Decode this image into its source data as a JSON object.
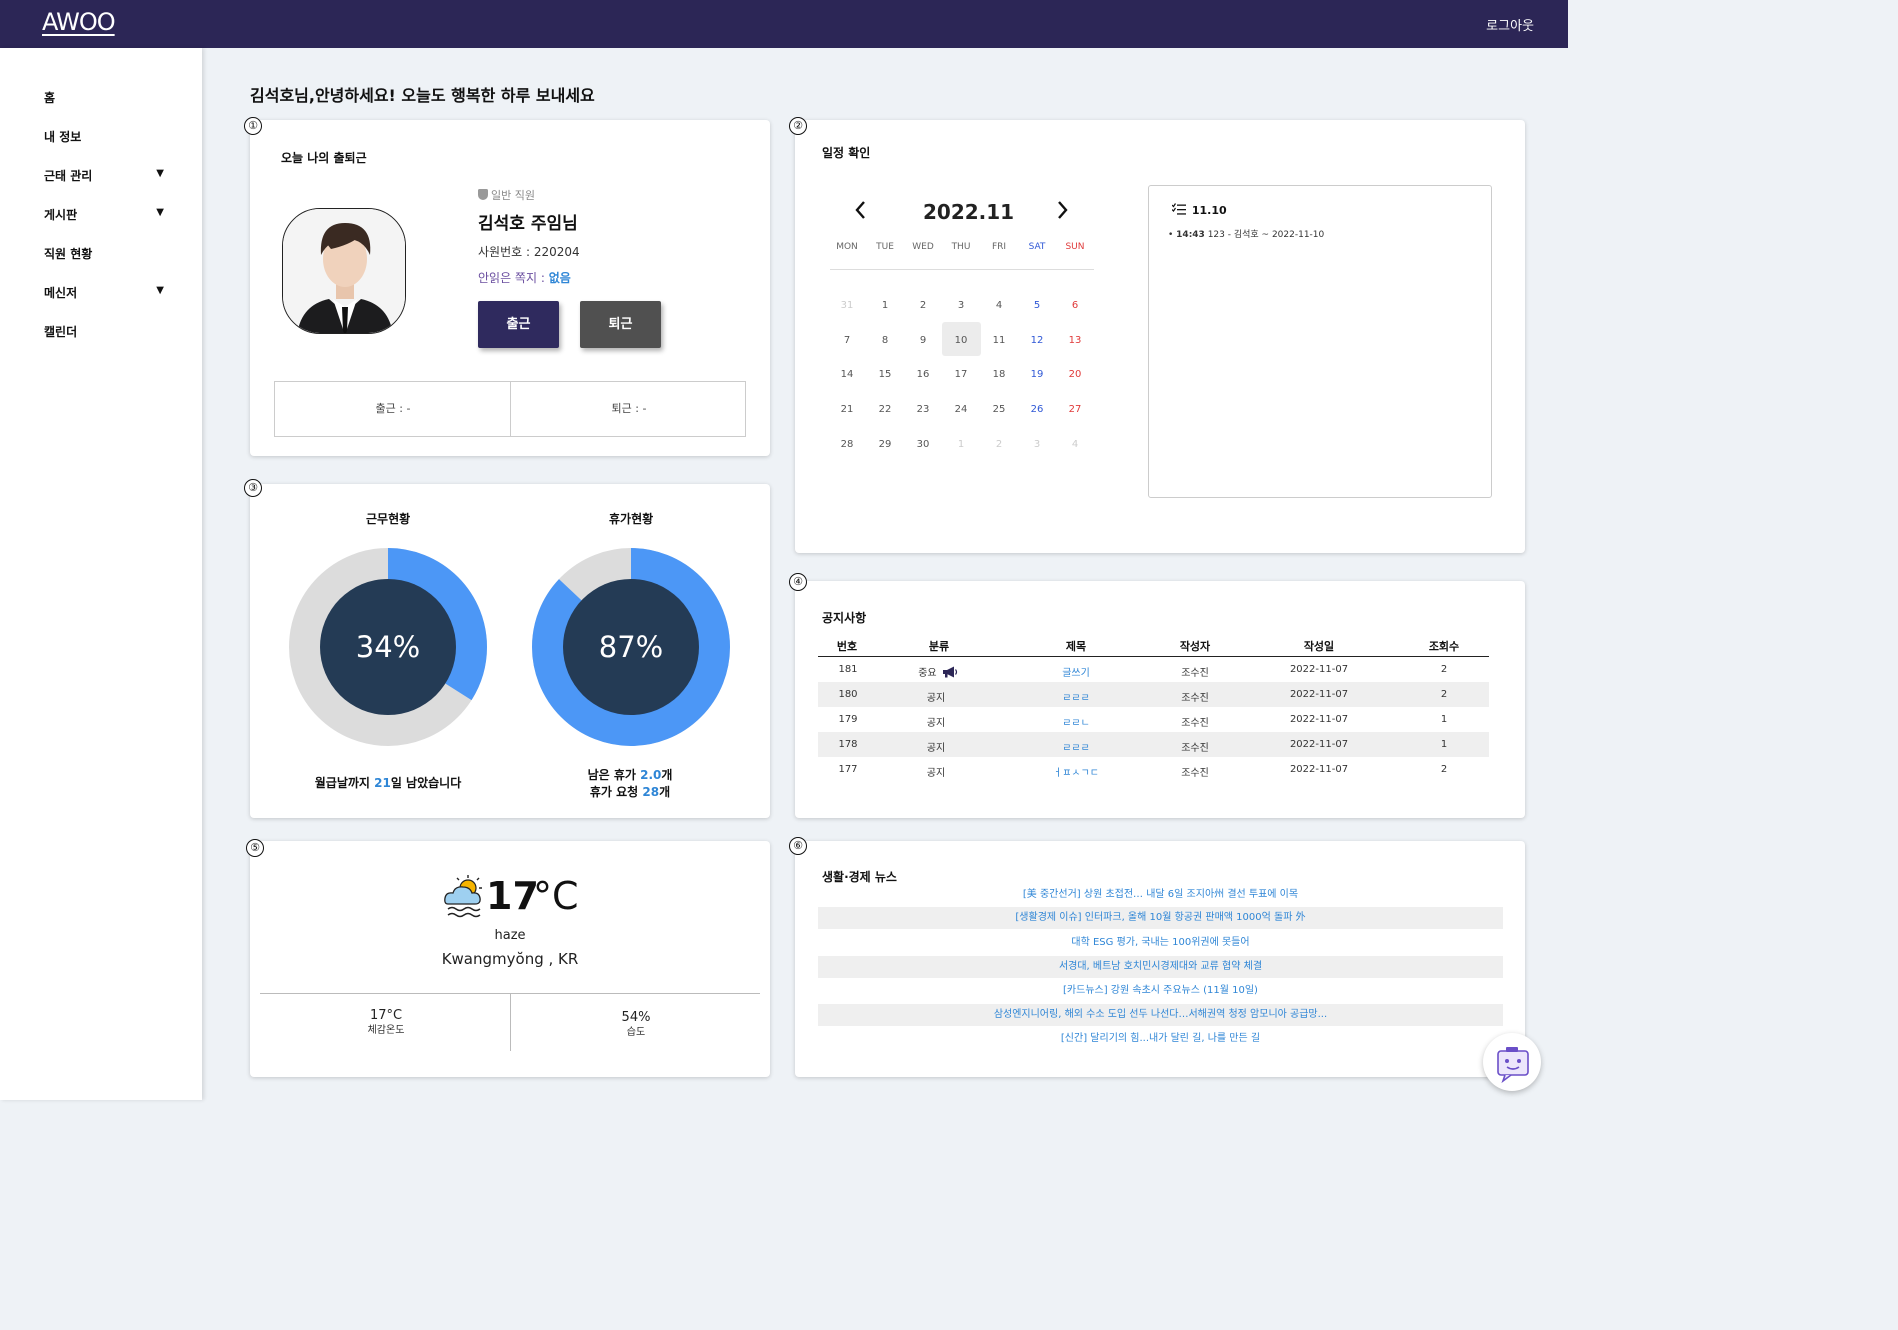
{
  "header": {
    "logo": "AWOO",
    "logout": "로그아웃"
  },
  "sidebar": {
    "items": [
      {
        "label": "홈",
        "has_submenu": false
      },
      {
        "label": "내 정보",
        "has_submenu": false
      },
      {
        "label": "근태 관리",
        "has_submenu": true
      },
      {
        "label": "게시판",
        "has_submenu": true
      },
      {
        "label": "직원 현황",
        "has_submenu": false
      },
      {
        "label": "메신저",
        "has_submenu": true
      },
      {
        "label": "캘린더",
        "has_submenu": false
      }
    ],
    "caret": "▼"
  },
  "greeting": "김석호님,안녕하세요! 오늘도 행복한 하루 보내세요",
  "markers": [
    "①",
    "②",
    "③",
    "④",
    "⑤",
    "⑥"
  ],
  "attendance": {
    "title": "오늘 나의 출퇴근",
    "role": "일반 직원",
    "name": "김석호 주임님",
    "employee_no": "사원번호 : 220204",
    "unread_label": "안읽은 쪽지 :",
    "unread_value": "없음",
    "btn_in": "출근",
    "btn_out": "퇴근",
    "in_time": "출근 : -",
    "out_time": "퇴근 : -"
  },
  "schedule": {
    "title": "일정 확인",
    "month": "2022.11",
    "prev": "‹",
    "next": "›",
    "weekdays": [
      "MON",
      "TUE",
      "WED",
      "THU",
      "FRI",
      "SAT",
      "SUN"
    ],
    "weeks": [
      [
        "31",
        "1",
        "2",
        "3",
        "4",
        "5",
        "6"
      ],
      [
        "7",
        "8",
        "9",
        "10",
        "11",
        "12",
        "13"
      ],
      [
        "14",
        "15",
        "16",
        "17",
        "18",
        "19",
        "20"
      ],
      [
        "21",
        "22",
        "23",
        "24",
        "25",
        "26",
        "27"
      ],
      [
        "28",
        "29",
        "30",
        "1",
        "2",
        "3",
        "4"
      ]
    ],
    "selected_date": "11.10",
    "event_time": "14:43",
    "event_text": " 123 - 김석호 ~ 2022-11-10"
  },
  "status": {
    "work_title": "근무현황",
    "work_pct_label": "34%",
    "work_pct": 34,
    "work_caption_pre": "월급날까지 ",
    "work_caption_num": "21",
    "work_caption_post": "일 남았습니다",
    "leave_title": "휴가현황",
    "leave_pct_label": "87%",
    "leave_pct": 87,
    "leave_line1_pre": "남은 휴가 ",
    "leave_line1_num": "2.0",
    "leave_line1_post": "개",
    "leave_line2_pre": "휴가 요청 ",
    "leave_line2_num": "28",
    "leave_line2_post": "개",
    "colors": {
      "fill": "#4c97f6",
      "track": "#dcdcdc",
      "center": "#243b55"
    }
  },
  "notice": {
    "title": "공지사항",
    "columns": [
      "번호",
      "분류",
      "제목",
      "작성자",
      "작성일",
      "조회수"
    ],
    "rows": [
      {
        "no": "181",
        "category": "중요",
        "title": "글쓰기",
        "author": "조수진",
        "date": "2022-11-07",
        "views": "2",
        "important": true
      },
      {
        "no": "180",
        "category": "공지",
        "title": "ㄹㄹㄹ",
        "author": "조수진",
        "date": "2022-11-07",
        "views": "2",
        "important": false
      },
      {
        "no": "179",
        "category": "공지",
        "title": "ㄹㄹㄴ",
        "author": "조수진",
        "date": "2022-11-07",
        "views": "1",
        "important": false
      },
      {
        "no": "178",
        "category": "공지",
        "title": "ㄹㄹㄹ",
        "author": "조수진",
        "date": "2022-11-07",
        "views": "1",
        "important": false
      },
      {
        "no": "177",
        "category": "공지",
        "title": "ㅓㅍㅅㄱㄷ",
        "author": "조수진",
        "date": "2022-11-07",
        "views": "2",
        "important": false
      }
    ]
  },
  "weather": {
    "temp": "17",
    "unit": "°C",
    "description": "haze",
    "location": "Kwangmyŏng , KR",
    "feels_value": "17°C",
    "feels_label": "체감온도",
    "humidity_value": "54%",
    "humidity_label": "습도"
  },
  "news": {
    "title": "생활·경제 뉴스",
    "items": [
      "[美 중간선거] 상원 초접전… 내달 6일 조지아州 결선 투표에 이목",
      "[생활경제 이슈] 인터파크, 올해 10월 항공권 판매액 1000억 돌파 外",
      "대학 ESG 평가, 국내는 100위권에 못들어",
      "서경대, 베트남 호치민시경제대와 교류 협약 체결",
      "[카드뉴스] 강원 속초시 주요뉴스 (11월 10일)",
      "삼성엔지니어링, 해외 수소 도입 선두 나선다…서해권역 청정 암모니아 공급망...",
      "[신간] 달리기의 힘...내가 달린 길, 나를 만든 길"
    ]
  }
}
